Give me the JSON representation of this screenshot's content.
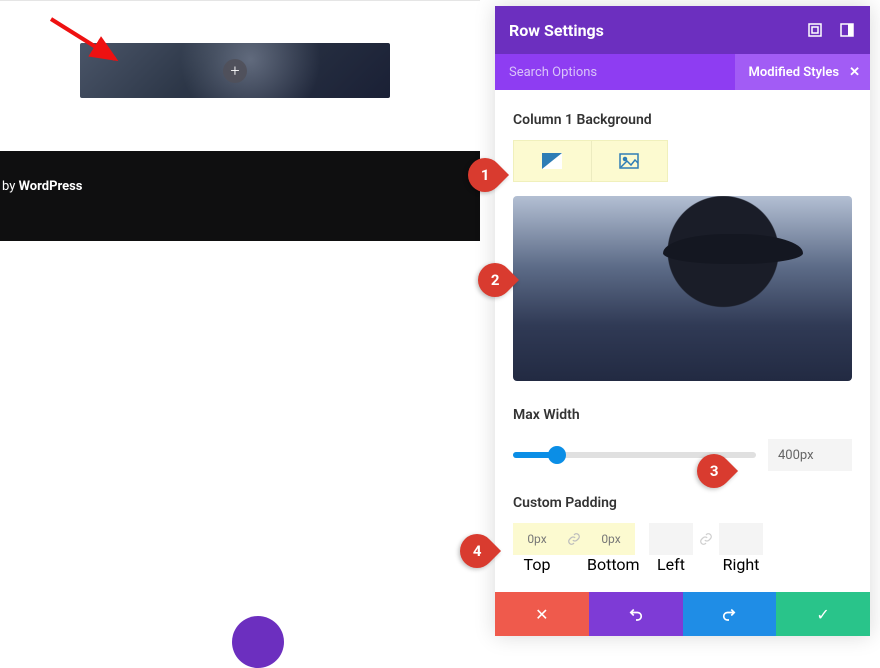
{
  "canvas": {
    "footer_prefix": "by ",
    "footer_bold": "WordPress"
  },
  "panel": {
    "title": "Row Settings",
    "search_placeholder": "Search Options",
    "pill_label": "Modified Styles"
  },
  "background": {
    "section_label": "Column 1 Background"
  },
  "maxwidth": {
    "label": "Max Width",
    "value": "400px"
  },
  "padding": {
    "label": "Custom Padding",
    "top_value": "0px",
    "bottom_value": "0px",
    "left_value": "",
    "right_value": "",
    "cap_top": "Top",
    "cap_bottom": "Bottom",
    "cap_left": "Left",
    "cap_right": "Right"
  },
  "callouts": {
    "c1": "1",
    "c2": "2",
    "c3": "3",
    "c4": "4"
  }
}
